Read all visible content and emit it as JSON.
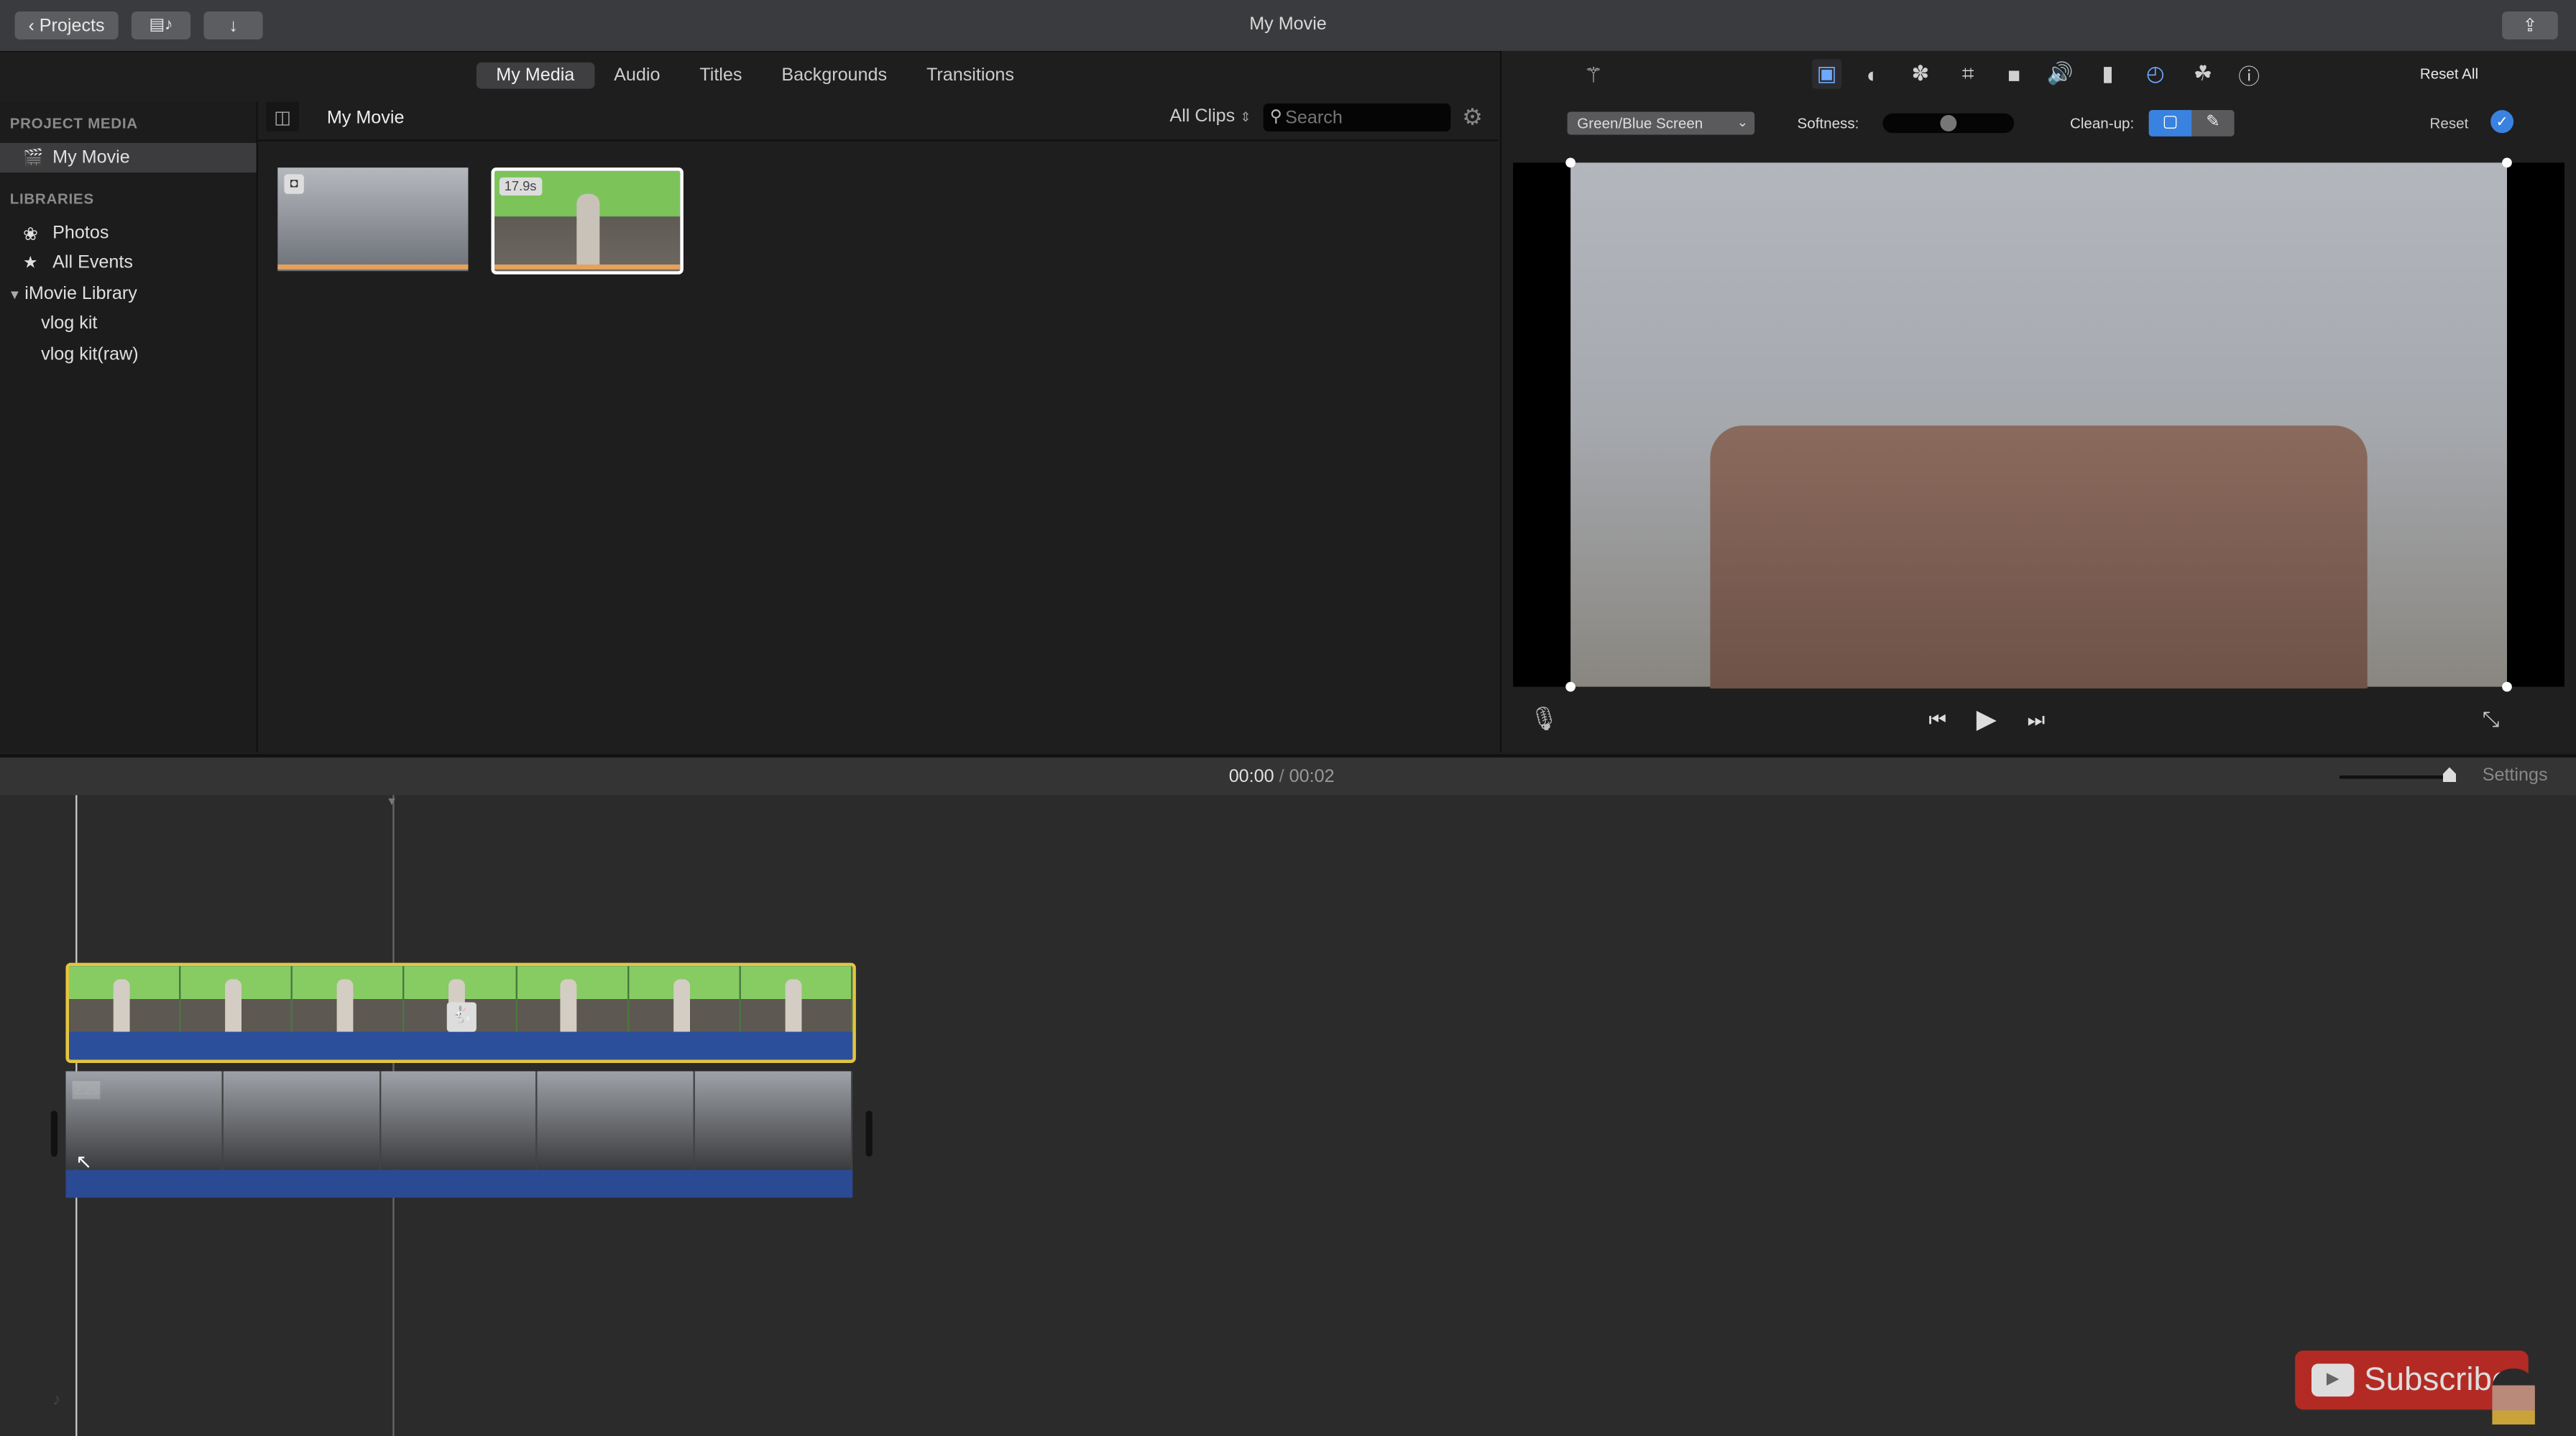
{
  "window": {
    "title": "My Movie"
  },
  "titlebar": {
    "projects_label": "Projects",
    "media_icon": "film-music-icon",
    "import_icon": "download-arrow-icon",
    "share_icon": "share-icon"
  },
  "browser_tabs": [
    {
      "label": "My Media",
      "active": true
    },
    {
      "label": "Audio",
      "active": false
    },
    {
      "label": "Titles",
      "active": false
    },
    {
      "label": "Backgrounds",
      "active": false
    },
    {
      "label": "Transitions",
      "active": false
    }
  ],
  "sidebar": {
    "project_media_heading": "PROJECT MEDIA",
    "project_item": "My Movie",
    "libraries_heading": "LIBRARIES",
    "items": [
      {
        "label": "Photos",
        "icon": "photos-icon"
      },
      {
        "label": "All Events",
        "icon": "star-icon"
      },
      {
        "label": "iMovie Library",
        "icon": "disclosure-triangle-icon"
      },
      {
        "label": "vlog kit"
      },
      {
        "label": "vlog kit(raw)"
      }
    ]
  },
  "browser": {
    "title": "My Movie",
    "filter": "All Clips",
    "search_placeholder": "Search",
    "clips": [
      {
        "type": "photo",
        "badge_icon": "camera-icon"
      },
      {
        "type": "video",
        "duration": "17.9s",
        "selected": true
      }
    ]
  },
  "inspector": {
    "reset_all": "Reset All",
    "tools": [
      "magic-wand",
      "video-overlay",
      "color-balance",
      "color-correction",
      "crop",
      "stabilization",
      "volume",
      "noise-reduction",
      "speed",
      "clip-filter",
      "info"
    ],
    "overlay_mode": "Green/Blue Screen",
    "softness_label": "Softness:",
    "softness_value": 0.5,
    "cleanup_label": "Clean-up:",
    "reset_label": "Reset"
  },
  "playback": {
    "current": "00:00",
    "separator": "/",
    "total": "00:02",
    "settings_label": "Settings",
    "zoom_level": 1.0
  },
  "timeline": {
    "main_clip": {
      "frames": 7,
      "selected": true
    },
    "background_clip": {
      "duration": "2.2s",
      "frames": 5
    }
  },
  "overlay": {
    "subscribe_label": "Subscribe"
  }
}
